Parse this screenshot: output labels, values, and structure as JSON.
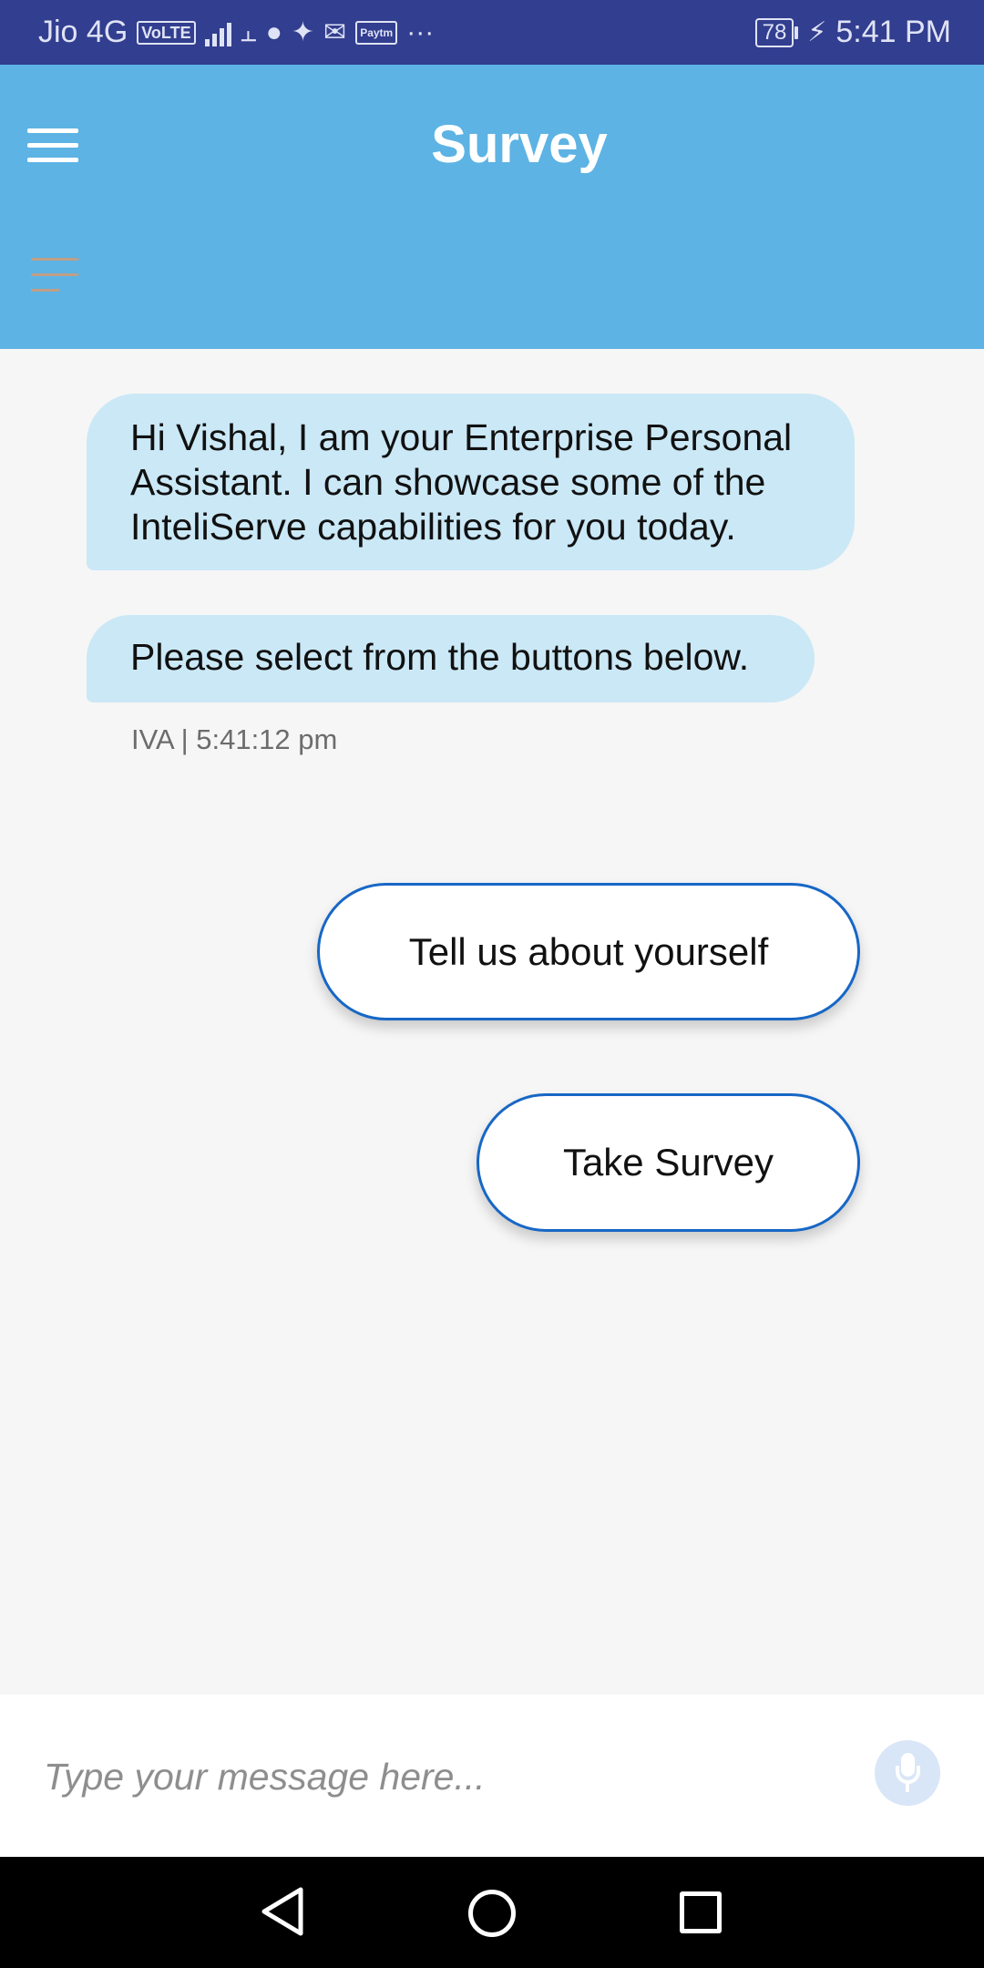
{
  "status_bar": {
    "carrier": "Jio 4G",
    "volte_badge": "VoLTE",
    "network_type": "4G",
    "battery": "78",
    "time": "5:41 PM",
    "paytm_badge": "Paytm",
    "more": "···"
  },
  "app_bar": {
    "title": "Survey",
    "background_color": "#5db3e4"
  },
  "chat": {
    "messages": [
      {
        "text": "Hi Vishal, I am your Enterprise Personal Assistant. I can showcase some of the InteliServe capabilities for you today."
      },
      {
        "text": "Please select from the buttons below."
      }
    ],
    "meta": "IVA | 5:41:12 pm",
    "quick_replies": [
      {
        "label": "Tell us about yourself"
      },
      {
        "label": "Take Survey"
      }
    ]
  },
  "input": {
    "placeholder": "Type your message here...",
    "value": ""
  },
  "colors": {
    "status_bar": "#323e8f",
    "bubble": "#cbe8f6",
    "button_border": "#1767c6"
  }
}
